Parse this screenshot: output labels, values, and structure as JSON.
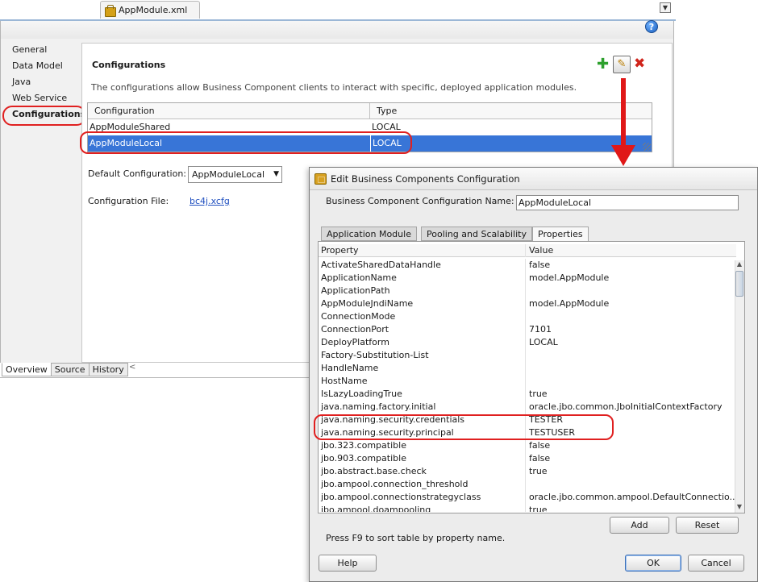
{
  "editor": {
    "file_tab": "AppModule.xml",
    "nav": [
      "General",
      "Data Model",
      "Java",
      "Web Service",
      "Configurations"
    ],
    "section_title": "Configurations",
    "description": "The configurations allow Business Component clients to interact with specific, deployed application modules.",
    "table": {
      "headers": [
        "Configuration",
        "Type"
      ],
      "rows": [
        [
          "AppModuleShared",
          "LOCAL"
        ],
        [
          "AppModuleLocal",
          "LOCAL"
        ]
      ]
    },
    "default_configuration_label": "Default Configuration:",
    "default_configuration_value": "AppModuleLocal",
    "configuration_file_label": "Configuration File:",
    "configuration_file_link": "bc4j.xcfg",
    "bottom_tabs": [
      "Overview",
      "Source",
      "History"
    ]
  },
  "dialog": {
    "title": "Edit Business Components Configuration",
    "name_label": "Business Component Configuration Name:",
    "name_value": "AppModuleLocal",
    "tabs": [
      "Application Module",
      "Pooling and Scalability",
      "Properties"
    ],
    "table_headers": [
      "Property",
      "Value"
    ],
    "properties": [
      [
        "ActivateSharedDataHandle",
        "false"
      ],
      [
        "ApplicationName",
        "model.AppModule"
      ],
      [
        "ApplicationPath",
        ""
      ],
      [
        "AppModuleJndiName",
        "model.AppModule"
      ],
      [
        "ConnectionMode",
        ""
      ],
      [
        "ConnectionPort",
        "7101"
      ],
      [
        "DeployPlatform",
        "LOCAL"
      ],
      [
        "Factory-Substitution-List",
        ""
      ],
      [
        "HandleName",
        ""
      ],
      [
        "HostName",
        ""
      ],
      [
        "IsLazyLoadingTrue",
        "true"
      ],
      [
        "java.naming.factory.initial",
        "oracle.jbo.common.JboInitialContextFactory"
      ],
      [
        "java.naming.security.credentials",
        "TESTER"
      ],
      [
        "java.naming.security.principal",
        "TESTUSER"
      ],
      [
        "jbo.323.compatible",
        "false"
      ],
      [
        "jbo.903.compatible",
        "false"
      ],
      [
        "jbo.abstract.base.check",
        "true"
      ],
      [
        "jbo.ampool.connection_threshold",
        ""
      ],
      [
        "jbo.ampool.connectionstrategyclass",
        "oracle.jbo.common.ampool.DefaultConnectio..."
      ],
      [
        "jbo.ampool.doampooling",
        "true"
      ]
    ],
    "add_label": "Add",
    "reset_label": "Reset",
    "hint": "Press F9 to sort table by property name.",
    "help_label": "Help",
    "ok_label": "OK",
    "cancel_label": "Cancel"
  },
  "icons": {
    "help": "help-icon",
    "add": "add-icon",
    "edit": "pencil-icon",
    "delete": "delete-icon"
  },
  "colors": {
    "selection": "#3875d7",
    "annotation_red": "#e02020"
  }
}
